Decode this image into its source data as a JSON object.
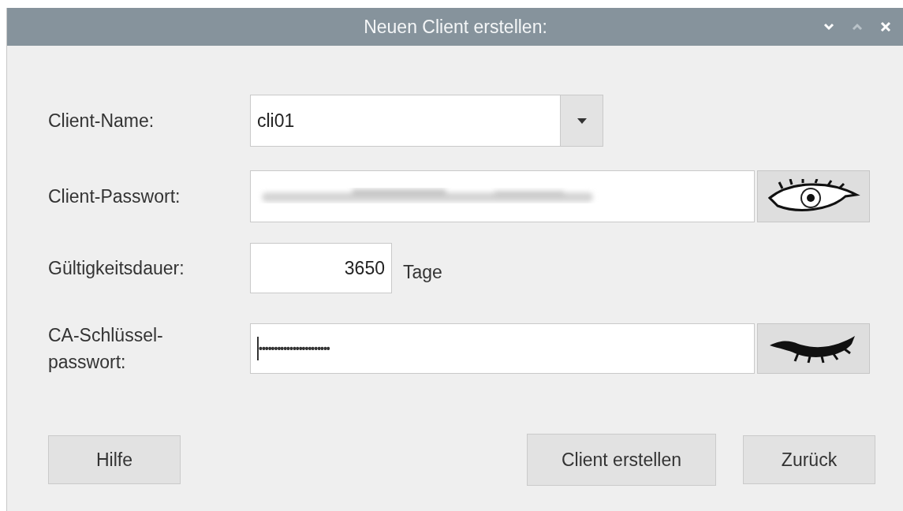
{
  "window": {
    "title": "Neuen Client erstellen:"
  },
  "fields": [
    {
      "kind": "combo",
      "label": "Client-Name:",
      "value": "cli01"
    },
    {
      "kind": "secret",
      "label": "Client-Passwort:",
      "redacted": true,
      "revealed": true
    },
    {
      "kind": "number",
      "label": "Gültigkeitsdauer:",
      "value": "3650",
      "unit": "Tage"
    },
    {
      "kind": "secret",
      "label": "CA-Schlüssel-\npasswort:",
      "redacted": false,
      "value": "•••••••••••••••••••••••",
      "focused": true,
      "revealed": false
    }
  ],
  "buttons": {
    "left": [
      "Hilfe"
    ],
    "right": [
      "Client erstellen",
      "Zurück"
    ]
  }
}
